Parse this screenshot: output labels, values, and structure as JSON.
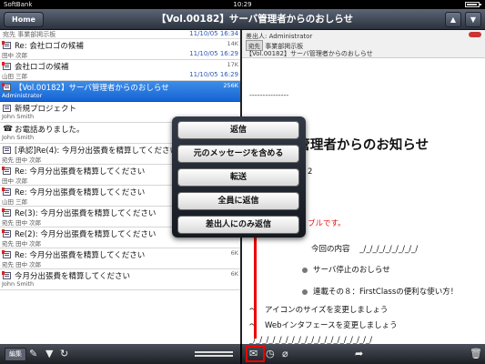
{
  "status": {
    "carrier": "SoftBank",
    "time": "10:29"
  },
  "nav": {
    "home": "Home",
    "title": "【Vol.00182】サーバ管理者からのおしらせ",
    "up": "▲",
    "down": "▼"
  },
  "list": {
    "top_sender": "宛先 事業部掲示板",
    "top_date": "11/10/05 16:34",
    "rows": [
      {
        "subject": "Re: 会社ロゴの候補",
        "size": "14K",
        "from": "田中 次郎",
        "date": "11/10/05 16:29",
        "icon": "mail-icon",
        "flag": true
      },
      {
        "subject": "会社ロゴの候補",
        "size": "17K",
        "from": "山田 三郎",
        "date": "11/10/05 16:29",
        "icon": "mail-icon",
        "flag": true
      },
      {
        "subject": "【Vol.00182】サーバ管理者からのおしらせ",
        "size": "256K",
        "from": "Administrator",
        "date": "",
        "icon": "mail-icon",
        "flag": true,
        "selected": true
      },
      {
        "subject": "新規プロジェクト",
        "size": "",
        "from": "John Smith",
        "date": "",
        "icon": "mail-icon",
        "flag": false
      },
      {
        "subject": "お電話ありました。",
        "size": "",
        "from": "John Smith",
        "date": "",
        "icon": "phone-icon",
        "flag": false
      },
      {
        "subject": "[承認]Re(4): 今月分出張費を精算してください",
        "size": "",
        "from": "宛先 田中 次郎",
        "date": "",
        "icon": "mail-icon",
        "flag": false
      },
      {
        "subject": "Re: 今月分出張費を精算してください",
        "size": "",
        "from": "田中 次郎",
        "date": "",
        "icon": "mail-icon",
        "flag": true
      },
      {
        "subject": "Re: 今月分出張費を精算してください",
        "size": "",
        "from": "山田 三郎",
        "date": "",
        "icon": "mail-icon",
        "flag": true
      },
      {
        "subject": "Re(3): 今月分出張費を精算してください",
        "size": "5K",
        "from": "宛先 田中 次郎",
        "date": "",
        "icon": "mail-icon",
        "flag": true
      },
      {
        "subject": "Re(2): 今月分出張費を精算してください",
        "size": "5K",
        "from": "宛先 田中 次郎",
        "date": "",
        "icon": "mail-icon",
        "flag": true
      },
      {
        "subject": "Re: 今月分出張費を精算してください",
        "size": "6K",
        "from": "宛先 田中 次郎",
        "date": "",
        "icon": "mail-icon",
        "flag": true
      },
      {
        "subject": "今月分出張費を精算してください",
        "size": "6K",
        "from": "John Smith",
        "date": "",
        "icon": "mail-icon",
        "flag": true
      }
    ]
  },
  "detail": {
    "sender_label": "差出人:",
    "sender": "Administrator",
    "to_label": "宛先",
    "to": "事業部掲示板",
    "subject": "【Vol.00182】サーバ管理者からのおしらせ",
    "dashes": "---------------",
    "big_title": "サーバ管理者からのお知らせ",
    "frag_2": "2",
    "frag_red": "ブルです。",
    "content_label": "今回の内容",
    "content_line": "_/_/_/_/_/_/_/_/_/",
    "item1": "サーバ停止のおしらせ",
    "item2": "連載その８：FirstClassの便利な使い方！",
    "note1": "〜　アイコンのサイズを変更しましょう",
    "note2": "〜　Webインタフェースを変更しましょう",
    "footer_line": "_/_/_/_/_/_/_/_/_/_/_/_/_/_/_/_/_/_/_/"
  },
  "popover": {
    "items": [
      "返信",
      "元のメッセージを含める",
      "転送",
      "全員に返信",
      "差出人にのみ返信"
    ]
  },
  "toolbar": {
    "edit": "編集"
  }
}
